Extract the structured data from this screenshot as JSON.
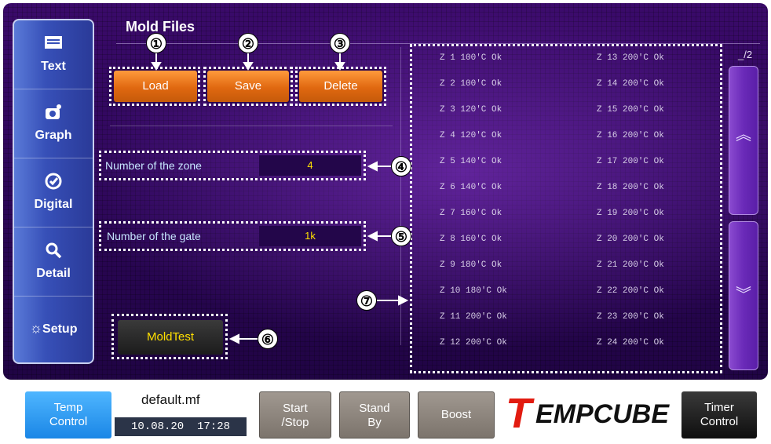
{
  "title": "Mold Files",
  "sidebar": {
    "items": [
      {
        "label": "Text",
        "icon": "folder-icon"
      },
      {
        "label": "Graph",
        "icon": "camera-icon"
      },
      {
        "label": "Digital",
        "icon": "gauge-icon"
      },
      {
        "label": "Detail",
        "icon": "magnifier-icon"
      },
      {
        "label": "Setup",
        "icon": "gear-icon"
      }
    ]
  },
  "buttons": {
    "load": "Load",
    "save": "Save",
    "delete": "Delete"
  },
  "fields": {
    "zone_label": "Number of the zone",
    "zone_value": "4",
    "gate_label": "Number of the gate",
    "gate_value": "1k"
  },
  "mold_name": "MoldTest",
  "page_indicator": "_/2",
  "zones_left": [
    "Z 1  100'C  Ok",
    "Z 2  100'C  Ok",
    "Z 3  120'C  Ok",
    "Z 4  120'C  Ok",
    "Z 5  140'C  Ok",
    "Z 6  140'C  Ok",
    "Z 7  160'C  Ok",
    "Z 8  160'C  Ok",
    "Z 9  180'C  Ok",
    "Z 10  180'C  Ok",
    "Z 11  200'C  Ok",
    "Z 12  200'C  Ok"
  ],
  "zones_right": [
    "Z 13  200'C  Ok",
    "Z 14  200'C  Ok",
    "Z 15  200'C  Ok",
    "Z 16  200'C  Ok",
    "Z 17  200'C  Ok",
    "Z 18  200'C  Ok",
    "Z 19  200'C  Ok",
    "Z 20  200'C  Ok",
    "Z 21  200'C  Ok",
    "Z 22  200'C  Ok",
    "Z 23  200'C  Ok",
    "Z 24  200'C  Ok"
  ],
  "callouts": [
    "①",
    "②",
    "③",
    "④",
    "⑤",
    "⑥",
    "⑦"
  ],
  "bottom": {
    "temp_control": "Temp\nControl",
    "file_name": "default.mf",
    "datetime": "10.08.20  17:28",
    "start_stop": "Start\n/Stop",
    "stand_by": "Stand\nBy",
    "boost": "Boost",
    "logo_lead": "T",
    "logo_rest": "EMPCUBE",
    "timer_control": "Timer\nControl"
  },
  "colors": {
    "accent_orange": "#e06810",
    "value_yellow": "#ffe000",
    "panel_purple": "#2c0658",
    "temp_blue": "#2a9df4"
  }
}
